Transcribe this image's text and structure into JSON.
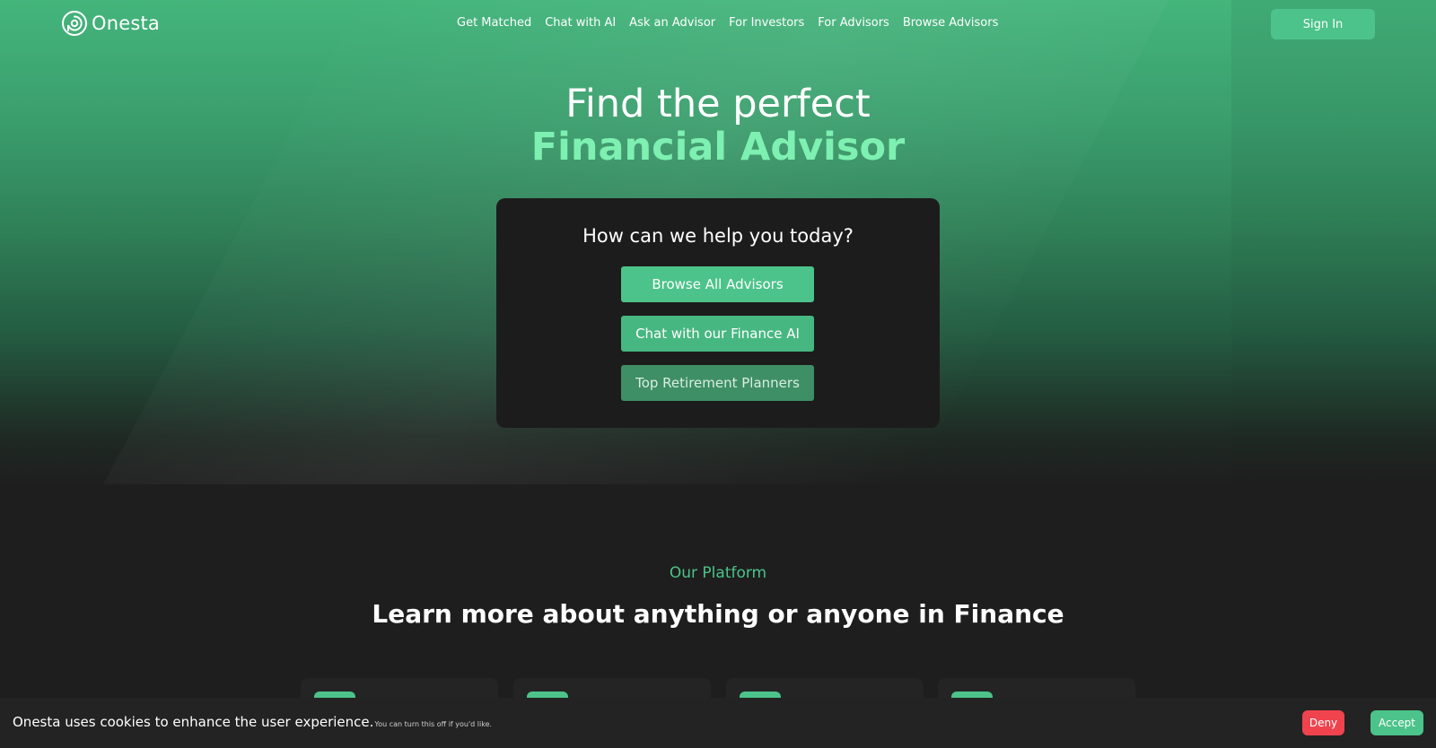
{
  "brand": {
    "name": "Onesta",
    "logo_icon": "onesta-logo-icon"
  },
  "nav": {
    "links": [
      "Get Matched",
      "Chat with AI",
      "Ask an Advisor",
      "For Investors",
      "For Advisors",
      "Browse Advisors"
    ],
    "signin_label": "Sign In"
  },
  "hero": {
    "line1": "Find the perfect",
    "line2": "Financial Advisor"
  },
  "help_card": {
    "title": "How can we help you today?",
    "buttons": [
      "Browse All Advisors",
      "Chat with our Finance AI",
      "Top Retirement Planners"
    ]
  },
  "platform": {
    "kicker": "Our Platform",
    "title": "Learn more about anything or anyone in Finance"
  },
  "cookie": {
    "message": "Onesta uses cookies to enhance the user experience.",
    "sub": "You can turn this off if you'd like.",
    "deny_label": "Deny",
    "accept_label": "Accept"
  },
  "colors": {
    "accent": "#4cc38a",
    "accent_light": "#7ef0b2",
    "deny": "#f0434e",
    "dark_bg": "#1e1e1e"
  }
}
